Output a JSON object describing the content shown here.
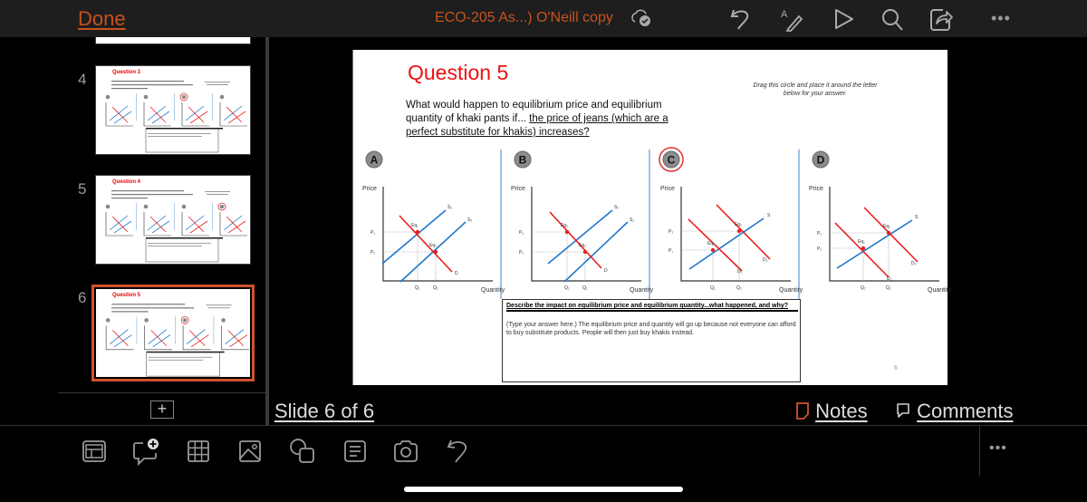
{
  "topbar": {
    "done_label": "Done",
    "doc_title": "ECO-205 As...) O'Neill copy",
    "icons": [
      "cloud-saved-icon",
      "undo-icon",
      "draw-icon",
      "play-icon",
      "search-icon",
      "share-icon",
      "more-icon"
    ],
    "more_label": "•••"
  },
  "sidebar": {
    "slides": [
      {
        "number": "4",
        "title": "Question 3",
        "selected_option": "C",
        "active": false
      },
      {
        "number": "5",
        "title": "Question 4",
        "selected_option": "D",
        "active": false
      },
      {
        "number": "6",
        "title": "Question 5",
        "selected_option": "C",
        "active": true
      }
    ],
    "add_slide_label": "+"
  },
  "slide": {
    "title": "Question 5",
    "question_plain": "What would happen to equilibrium price and equilibrium quantity of khaki pants if... ",
    "question_underlined": "the price of jeans (which are a perfect substitute for khakis) increases?",
    "drag_note": "Drag this circle and place it around the letter below for your answer.",
    "selected_answer": "C",
    "panels": [
      {
        "letter": "A",
        "y_label": "Price",
        "x_label": "Quantity",
        "curves": [
          "S₁",
          "S₂",
          "D"
        ],
        "eq_labels": [
          "Eq₁",
          "Eq₂"
        ],
        "price_ticks": [
          "P₁",
          "P₂"
        ],
        "qty_ticks": [
          "Q₁",
          "Q₂"
        ],
        "shift": "supply-right"
      },
      {
        "letter": "B",
        "y_label": "Price",
        "x_label": "Quantity",
        "curves": [
          "S₂",
          "S₁",
          "D"
        ],
        "eq_labels": [
          "Eq₂",
          "Eq₁"
        ],
        "price_ticks": [
          "P₂",
          "P₁"
        ],
        "qty_ticks": [
          "Q₂",
          "Q₁"
        ],
        "shift": "supply-left"
      },
      {
        "letter": "C",
        "y_label": "Price",
        "x_label": "Quantity",
        "curves": [
          "S",
          "D₁",
          "D₂"
        ],
        "eq_labels": [
          "Eq₁",
          "Eq₂"
        ],
        "price_ticks": [
          "P₂",
          "P₁"
        ],
        "qty_ticks": [
          "Q₁",
          "Q₂"
        ],
        "shift": "demand-right"
      },
      {
        "letter": "D",
        "y_label": "Price",
        "x_label": "Quantity",
        "curves": [
          "S",
          "D₁",
          "D₂"
        ],
        "eq_labels": [
          "Eq₁",
          "Eq₂"
        ],
        "price_ticks": [
          "P₁",
          "P₂"
        ],
        "qty_ticks": [
          "Q₂",
          "Q₁"
        ],
        "shift": "demand-left"
      }
    ],
    "answer_prompt": "Describe the impact on equilibrium price and equilibrium quantity...what happened, and why?",
    "answer_text": "(Type your answer here.) The equilibrium price and quantity will go up because not everyone can afford to buy substitute products. People will then just buy khakis instead.",
    "page_number": "6"
  },
  "status": {
    "slide_indicator": "Slide 6 of 6",
    "notes_label": "Notes",
    "comments_label": "Comments"
  },
  "bottombar": {
    "icons": [
      "layout-icon",
      "new-comment-icon",
      "table-icon",
      "picture-icon",
      "shapes-icon",
      "text-box-icon",
      "camera-icon",
      "undo-icon"
    ],
    "more_label": "•••"
  },
  "colors": {
    "accent": "#c8521e",
    "supply": "#1f77c9",
    "demand": "#e81f1f",
    "title_red": "#ee1111"
  }
}
